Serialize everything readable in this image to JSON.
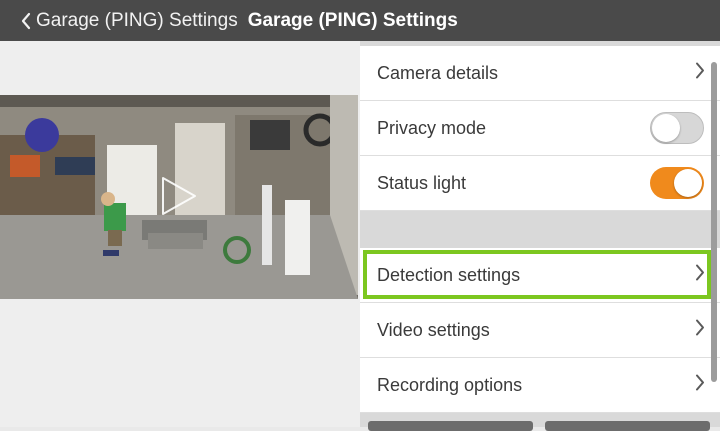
{
  "header": {
    "back_label": "Garage (PING) Settings",
    "title": "Garage (PING) Settings"
  },
  "settings": {
    "camera_details": "Camera details",
    "privacy_mode": {
      "label": "Privacy mode",
      "enabled": false
    },
    "status_light": {
      "label": "Status light",
      "enabled": true
    },
    "detection_settings": "Detection settings",
    "video_settings": "Video settings",
    "recording_options": "Recording options"
  },
  "colors": {
    "accent_toggle": "#f08a1c",
    "highlight": "#7cc720",
    "title_bar": "#4a4a4a"
  },
  "icons": [
    "chevron-left-icon",
    "chevron-right-icon",
    "play-icon"
  ]
}
